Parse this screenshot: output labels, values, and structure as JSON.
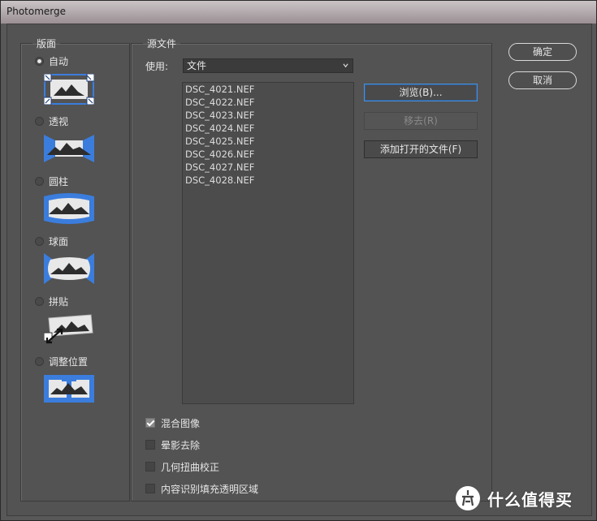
{
  "window": {
    "title": "Photomerge"
  },
  "layout": {
    "legend": "版面",
    "options": [
      {
        "label": "自动",
        "checked": true,
        "icon": "auto-layout-icon"
      },
      {
        "label": "透视",
        "checked": false,
        "icon": "perspective-layout-icon"
      },
      {
        "label": "圆柱",
        "checked": false,
        "icon": "cylindrical-layout-icon"
      },
      {
        "label": "球面",
        "checked": false,
        "icon": "spherical-layout-icon"
      },
      {
        "label": "拼贴",
        "checked": false,
        "icon": "collage-layout-icon"
      },
      {
        "label": "调整位置",
        "checked": false,
        "icon": "reposition-layout-icon"
      }
    ]
  },
  "source": {
    "legend": "源文件",
    "use_label": "使用:",
    "use_value": "文件",
    "files": [
      "DSC_4021.NEF",
      "DSC_4022.NEF",
      "DSC_4023.NEF",
      "DSC_4024.NEF",
      "DSC_4025.NEF",
      "DSC_4026.NEF",
      "DSC_4027.NEF",
      "DSC_4028.NEF"
    ],
    "browse_label": "浏览(B)...",
    "remove_label": "移去(R)",
    "add_open_label": "添加打开的文件(F)",
    "options": [
      {
        "label": "混合图像",
        "checked": true
      },
      {
        "label": "晕影去除",
        "checked": false
      },
      {
        "label": "几何扭曲校正",
        "checked": false
      },
      {
        "label": "内容识别填充透明区域",
        "checked": false
      }
    ]
  },
  "actions": {
    "ok_label": "确定",
    "cancel_label": "取消"
  },
  "watermark": {
    "text": "什么值得买",
    "logo_char": "值"
  },
  "colors": {
    "accent_blue": "#3b7ddd",
    "panel": "#535353",
    "list": "#4c4c4c"
  }
}
